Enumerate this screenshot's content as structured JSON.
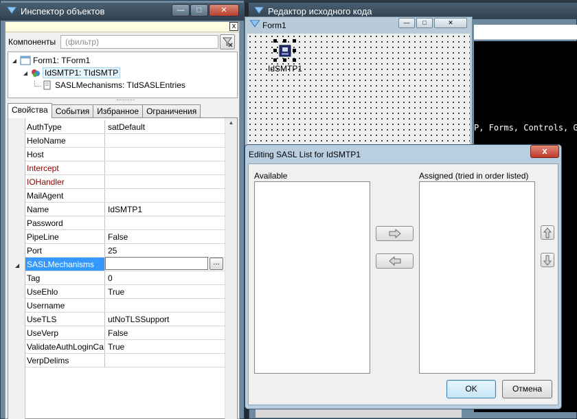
{
  "inspector": {
    "title": "Инспектор объектов",
    "components_label": "Компоненты",
    "filter_placeholder": "(фильтр)",
    "tree": [
      {
        "label": "Form1: TForm1"
      },
      {
        "label": "IdSMTP1: TIdSMTP"
      },
      {
        "label": "SASLMechanisms: TIdSASLEntries"
      }
    ],
    "tabs": [
      "Свойства",
      "События",
      "Избранное",
      "Ограничения"
    ],
    "properties": [
      {
        "name": "AuthType",
        "value": "satDefault"
      },
      {
        "name": "HeloName",
        "value": ""
      },
      {
        "name": "Host",
        "value": ""
      },
      {
        "name": "Intercept",
        "value": ""
      },
      {
        "name": "IOHandler",
        "value": ""
      },
      {
        "name": "MailAgent",
        "value": ""
      },
      {
        "name": "Name",
        "value": "IdSMTP1"
      },
      {
        "name": "Password",
        "value": ""
      },
      {
        "name": "PipeLine",
        "value": "False"
      },
      {
        "name": "Port",
        "value": "25"
      },
      {
        "name": "SASLMechanisms",
        "value": ""
      },
      {
        "name": "Tag",
        "value": "0"
      },
      {
        "name": "UseEhlo",
        "value": "True"
      },
      {
        "name": "Username",
        "value": ""
      },
      {
        "name": "UseTLS",
        "value": "utNoTLSSupport"
      },
      {
        "name": "UseVerp",
        "value": "False"
      },
      {
        "name": "ValidateAuthLoginCa",
        "value": "True"
      },
      {
        "name": "VerpDelims",
        "value": ""
      }
    ],
    "ellipsis": "...",
    "close_x": "x"
  },
  "source_editor": {
    "title": "Редактор исходного кода",
    "code_line": "P, Forms, Controls, Gr"
  },
  "form1": {
    "title": "Form1",
    "component_label": "IdSMTP1"
  },
  "sasl_dialog": {
    "title": "Editing SASL List for IdSMTP1",
    "available_label": "Available",
    "assigned_label": "Assigned (tried in order listed)",
    "ok_label": "OK",
    "cancel_label": "Отмена",
    "close_glyph": "x"
  },
  "colors": {
    "selection": "#3399ff",
    "event_property": "#800000",
    "hint_background": "#ffffe1"
  }
}
